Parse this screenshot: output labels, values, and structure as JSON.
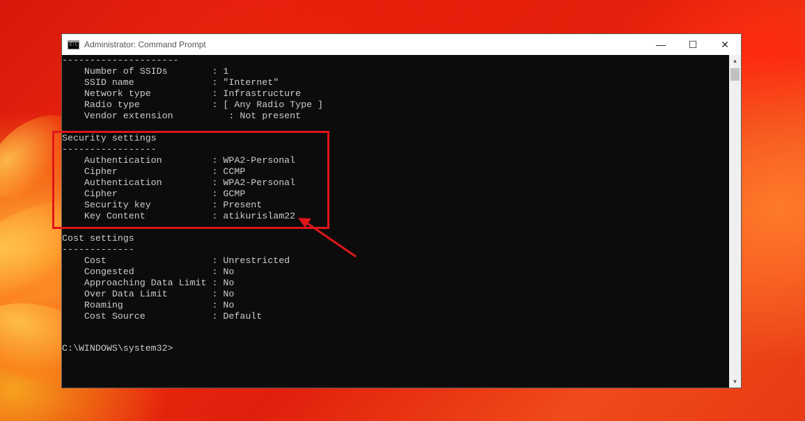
{
  "window": {
    "title": "Administrator: Command Prompt",
    "icon_label": "C:\\",
    "controls": {
      "minimize": "—",
      "maximize": "☐",
      "close": "✕"
    }
  },
  "console_lines": [
    "---------------------",
    "    Number of SSIDs        : 1",
    "    SSID name              : \"Internet\"",
    "    Network type           : Infrastructure",
    "    Radio type             : [ Any Radio Type ]",
    "    Vendor extension          : Not present",
    "",
    "Security settings",
    "-----------------",
    "    Authentication         : WPA2-Personal",
    "    Cipher                 : CCMP",
    "    Authentication         : WPA2-Personal",
    "    Cipher                 : GCMP",
    "    Security key           : Present",
    "    Key Content            : atikurislam22",
    "",
    "Cost settings",
    "-------------",
    "    Cost                   : Unrestricted",
    "    Congested              : No",
    "    Approaching Data Limit : No",
    "    Over Data Limit        : No",
    "    Roaming                : No",
    "    Cost Source            : Default",
    "",
    "",
    "C:\\WINDOWS\\system32>"
  ],
  "annotation": {
    "highlight_color": "#e1151a",
    "icon": "arrow-icon"
  },
  "scrollbar": {
    "up_arrow": "▲",
    "down_arrow": "▼"
  }
}
